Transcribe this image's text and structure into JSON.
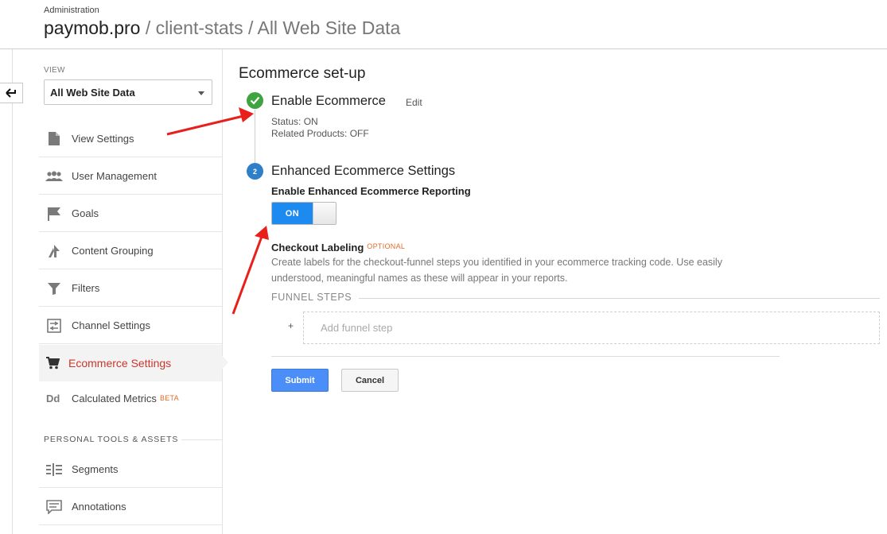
{
  "header": {
    "admin_label": "Administration",
    "account": "paymob.pro",
    "property": " / client-stats",
    "view": " / All Web Site Data"
  },
  "sidebar": {
    "view_label": "VIEW",
    "view_selected": "All Web Site Data",
    "items": [
      {
        "label": "View Settings",
        "icon": "document-icon"
      },
      {
        "label": "User Management",
        "icon": "users-icon"
      },
      {
        "label": "Goals",
        "icon": "flag-icon"
      },
      {
        "label": "Content Grouping",
        "icon": "content-grouping-icon"
      },
      {
        "label": "Filters",
        "icon": "funnel-icon"
      },
      {
        "label": "Channel Settings",
        "icon": "channel-settings-icon"
      },
      {
        "label": "Ecommerce Settings",
        "icon": "cart-icon",
        "active": true
      },
      {
        "label": "Calculated Metrics",
        "icon": "dd-icon",
        "badge": "BETA"
      }
    ],
    "section_heading": "PERSONAL TOOLS & ASSETS",
    "tools": [
      {
        "label": "Segments",
        "icon": "segments-icon"
      },
      {
        "label": "Annotations",
        "icon": "annotations-icon"
      }
    ]
  },
  "main": {
    "title": "Ecommerce set-up",
    "step1": {
      "title": "Enable Ecommerce",
      "edit": "Edit",
      "status": "Status: ON",
      "related": "Related Products: OFF"
    },
    "step2": {
      "number": "2",
      "title": "Enhanced Ecommerce Settings",
      "reporting_label": "Enable Enhanced Ecommerce Reporting",
      "toggle_state": "ON"
    },
    "checkout": {
      "label": "Checkout Labeling",
      "optional": "OPTIONAL",
      "description": "Create labels for the checkout-funnel steps you identified in your ecommerce tracking code. Use easily understood, meaningful names as these will appear in your reports.",
      "funnel_heading": "FUNNEL STEPS",
      "plus": "+",
      "add_step": "Add funnel step"
    },
    "buttons": {
      "submit": "Submit",
      "cancel": "Cancel"
    }
  },
  "colors": {
    "active_nav": "#c8372d",
    "toggle_on": "#1d8af0",
    "check_green": "#3fa33f",
    "step_blue": "#2d7fc9",
    "submit_blue": "#4c8ef7",
    "annotation_arrow": "#e8201c"
  }
}
